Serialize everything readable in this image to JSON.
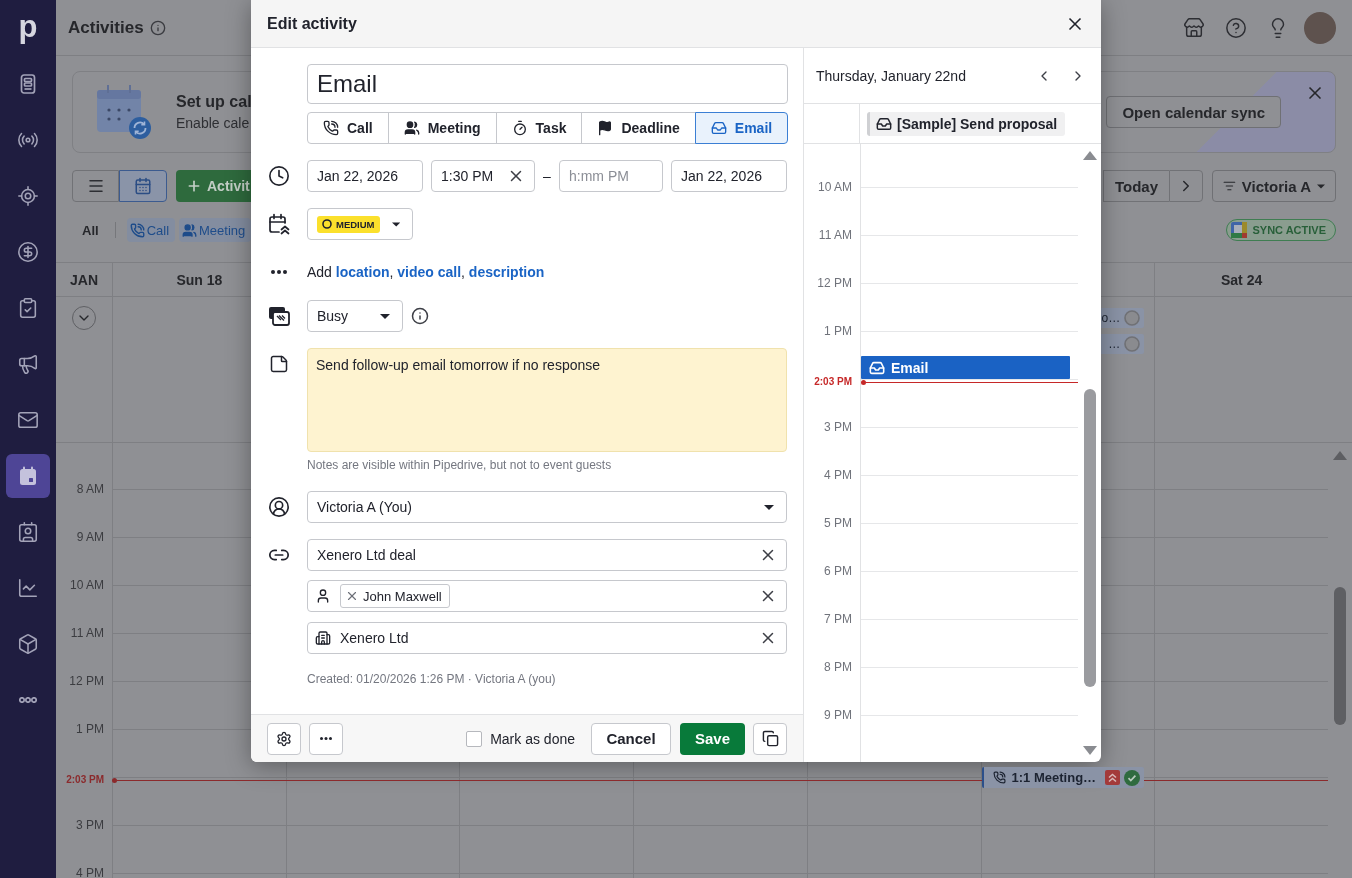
{
  "sidebar": {
    "logo": "p",
    "items": [
      {
        "selected": false
      },
      {
        "selected": false
      },
      {
        "selected": false
      },
      {
        "selected": false
      },
      {
        "selected": false
      },
      {
        "selected": false
      },
      {
        "selected": false
      },
      {
        "selected": true
      },
      {
        "selected": false
      },
      {
        "selected": false
      },
      {
        "selected": false
      },
      {
        "selected": false
      }
    ]
  },
  "header": {
    "title": "Activities"
  },
  "banner": {
    "title": "Set up cal",
    "subtitle": "Enable cale",
    "button": "Open calendar sync"
  },
  "toolbar": {
    "views": [
      {
        "selected": false
      },
      {
        "selected": true
      }
    ],
    "add_button": "Activit",
    "today_button": "Today",
    "owner_filter": "Victoria A"
  },
  "type_filters": [
    {
      "kind": "all",
      "label": "All",
      "selected": false
    },
    {
      "kind": "call",
      "label": "Call",
      "selected": true
    },
    {
      "kind": "meeting",
      "label": "Meeting",
      "selected": true
    }
  ],
  "sync_status": "SYNC ACTIVE",
  "calendar": {
    "month": "JAN",
    "days": [
      {
        "label": "Sun 18"
      },
      {
        "all_day": [
          {
            "title": "o…",
            "done": false
          },
          {
            "title": "…",
            "done": false
          }
        ],
        "events": [
          {
            "kind": "call",
            "title": "1:1 Meeting…",
            "high_priority": true,
            "done": true
          }
        ]
      },
      {
        "label": "Sat 24"
      }
    ],
    "rows": [
      {
        "label": "8 AM"
      },
      {
        "label": "9 AM"
      },
      {
        "label": "10 AM"
      },
      {
        "label": "11 AM"
      },
      {
        "label": "12 PM"
      },
      {
        "label": "1 PM"
      },
      {
        "now": "2:03 PM"
      },
      {
        "label": "3 PM"
      },
      {
        "label": "4 PM"
      }
    ]
  },
  "modal": {
    "title": "Edit activity",
    "subject": "Email",
    "types": [
      {
        "kind": "call",
        "label": "Call",
        "selected": false
      },
      {
        "kind": "meeting",
        "label": "Meeting",
        "selected": false
      },
      {
        "kind": "task",
        "label": "Task",
        "selected": false
      },
      {
        "kind": "deadline",
        "label": "Deadline",
        "selected": false
      },
      {
        "kind": "email",
        "label": "Email",
        "selected": true
      }
    ],
    "start_date": "Jan 22, 2026",
    "start_time": "1:30 PM",
    "range_separator": "–",
    "end_time": {
      "placeholder": "h:mm PM"
    },
    "end_date": "Jan 22, 2026",
    "priority": {
      "kind": "medium",
      "label": "MEDIUM"
    },
    "details": {
      "text": "Add",
      "links": [
        {
          "label": "location",
          "after": ","
        },
        {
          "label": "video call",
          "after": ","
        },
        {
          "label": "description"
        }
      ]
    },
    "availability": "Busy",
    "note": "Send follow-up email tomorrow if no response",
    "note_hint": "Notes are visible within Pipedrive, but not to event guests",
    "owner": "Victoria A (You)",
    "deal": "Xenero Ltd deal",
    "participants": [
      {
        "name": "John Maxwell"
      }
    ],
    "organization": "Xenero Ltd",
    "created": "Created: 01/20/2026 1:26 PM · Victoria A (you)",
    "mark_done": {
      "label": "Mark as done",
      "checked": false
    },
    "cancel_button": "Cancel",
    "save_button": "Save"
  },
  "day_view": {
    "title": "Thursday, January 22nd",
    "all_day": [
      {
        "kind": "email",
        "title": "[Sample] Send proposal"
      }
    ],
    "rows": [
      {
        "label": "10 AM"
      },
      {
        "label": "11 AM"
      },
      {
        "label": "12 PM"
      },
      {
        "label": "1 PM",
        "events": [
          {
            "kind": "email",
            "title": "Email"
          }
        ]
      },
      {
        "now": "2:03 PM"
      },
      {
        "label": "3 PM"
      },
      {
        "label": "4 PM"
      },
      {
        "label": "5 PM"
      },
      {
        "label": "6 PM"
      },
      {
        "label": "7 PM"
      },
      {
        "label": "8 PM"
      },
      {
        "label": "9 PM"
      }
    ]
  }
}
